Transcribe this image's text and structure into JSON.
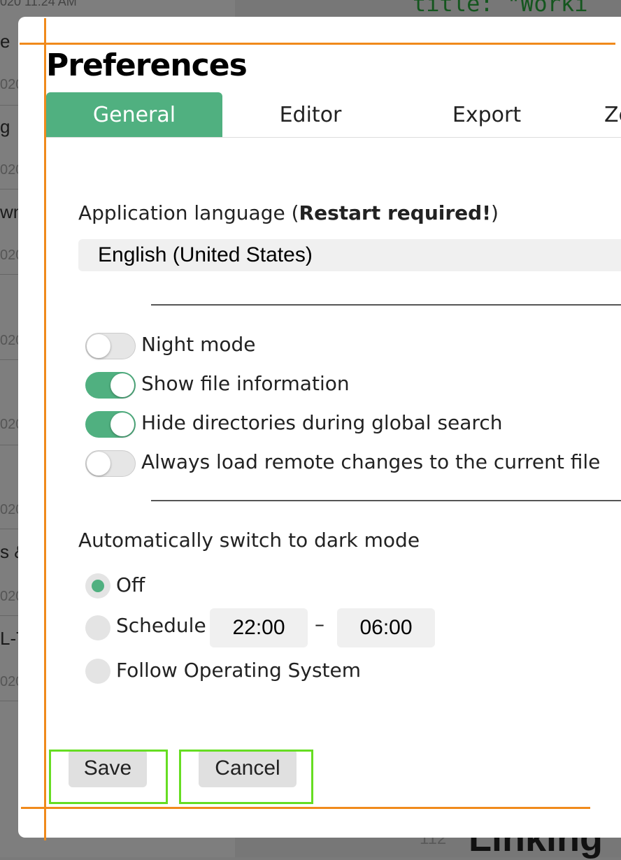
{
  "background": {
    "top_date": "020 11:24 AM",
    "notes": [
      {
        "title": "e",
        "date": "020"
      },
      {
        "title": "g",
        "date": "020"
      },
      {
        "title": "wn",
        "date": "020"
      },
      {
        "title": "",
        "date": "020"
      },
      {
        "title": "",
        "date": "020"
      },
      {
        "title": "",
        "date": "020"
      },
      {
        "title": "s &",
        "date": "020"
      },
      {
        "title": "L-T",
        "date": "020"
      }
    ],
    "code_line": "title: \"Worki",
    "line_number": "112",
    "heading": "Linking"
  },
  "dialog": {
    "title": "Preferences",
    "tabs": [
      {
        "label": "General",
        "active": true
      },
      {
        "label": "Editor",
        "active": false
      },
      {
        "label": "Export",
        "active": false
      },
      {
        "label": "Ze",
        "active": false
      }
    ],
    "language": {
      "label_prefix": "Application language (",
      "label_bold": "Restart required!",
      "label_suffix": ")",
      "value": "English (United States)"
    },
    "toggles": [
      {
        "label": "Night mode",
        "on": false
      },
      {
        "label": "Show file information",
        "on": true
      },
      {
        "label": "Hide directories during global search",
        "on": true
      },
      {
        "label": "Always load remote changes to the current file",
        "on": false
      }
    ],
    "dark_mode": {
      "label": "Automatically switch to dark mode",
      "options": [
        {
          "label": "Off",
          "selected": true
        },
        {
          "label": "Schedule",
          "selected": false
        },
        {
          "label": "Follow Operating System",
          "selected": false
        }
      ],
      "schedule_start": "22:00",
      "schedule_dash": "–",
      "schedule_end": "06:00"
    },
    "buttons": {
      "save": "Save",
      "cancel": "Cancel"
    }
  },
  "colors": {
    "accent": "#50b080",
    "overlay_line": "#f08a1c",
    "overlay_box": "#66dd22"
  }
}
